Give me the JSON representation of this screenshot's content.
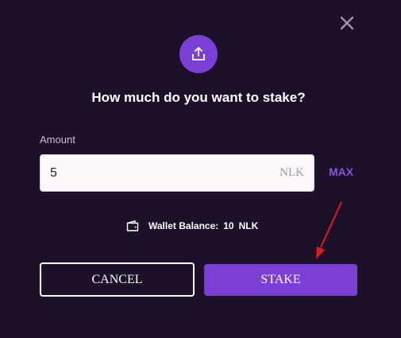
{
  "dialog": {
    "title": "How much do you want to stake?",
    "header_icon": "share-upload-icon",
    "close_icon": "close-icon"
  },
  "amount": {
    "label": "Amount",
    "value": "5",
    "unit": "NLK",
    "max_label": "MAX"
  },
  "wallet": {
    "icon": "wallet-icon",
    "label": "Wallet Balance:",
    "value": "10",
    "unit": "NLK"
  },
  "actions": {
    "cancel_label": "CANCEL",
    "stake_label": "STAKE"
  },
  "colors": {
    "background": "#1d1029",
    "accent": "#7b3fd6",
    "max_text": "#8b4fe6",
    "annotation_arrow": "#e01b1b"
  }
}
